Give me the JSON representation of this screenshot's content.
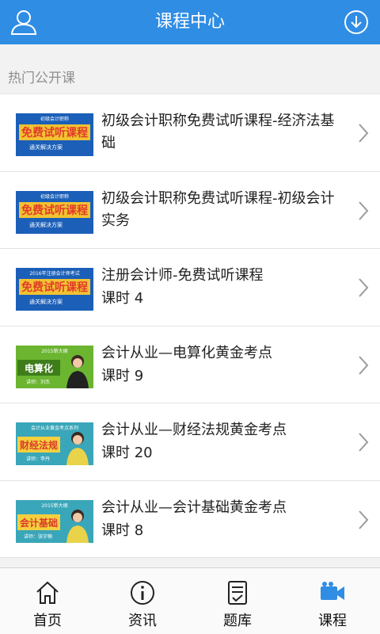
{
  "header": {
    "title": "课程中心"
  },
  "section": {
    "title": "热门公开课"
  },
  "courses": [
    {
      "title": "初级会计职称免费试听课程-经济法基础",
      "subtitle": "",
      "thumb": {
        "kind": "blue",
        "top": "初级会计职称",
        "big": "免费试听课程",
        "bottom": "通关解决方案"
      }
    },
    {
      "title": "初级会计职称免费试听课程-初级会计实务",
      "subtitle": "",
      "thumb": {
        "kind": "blue",
        "top": "初级会计职称",
        "big": "免费试听课程",
        "bottom": "通关解决方案"
      }
    },
    {
      "title": "注册会计师-免费试听课程",
      "subtitle": "课时 4",
      "thumb": {
        "kind": "blue",
        "top": "2016年注册会计师考试",
        "big": "免费试听课程",
        "bottom": "通关解决方案"
      }
    },
    {
      "title": "会计从业—电算化黄金考点",
      "subtitle": "课时 9",
      "thumb": {
        "kind": "green",
        "top": "2015新大纲",
        "big": "电算化",
        "bottom": "讲师：刘杰"
      }
    },
    {
      "title": "会计从业—财经法规黄金考点",
      "subtitle": "课时 20",
      "thumb": {
        "kind": "teal",
        "top": "会计从业黄金考点系列",
        "big": "财经法规",
        "bottom": "讲师：李丹"
      }
    },
    {
      "title": "会计从业—会计基础黄金考点",
      "subtitle": "课时 8",
      "thumb": {
        "kind": "teal",
        "top": "2015新大纲",
        "big": "会计基础",
        "bottom": "讲师：张宇楠"
      }
    }
  ],
  "tabs": [
    {
      "label": "首页",
      "icon": "home-icon",
      "active": false
    },
    {
      "label": "资讯",
      "icon": "info-icon",
      "active": false
    },
    {
      "label": "题库",
      "icon": "quiz-icon",
      "active": false
    },
    {
      "label": "课程",
      "icon": "video-icon",
      "active": true
    }
  ],
  "colors": {
    "header": "#2f8de4",
    "active_tab": "#2f8de4",
    "thumb_blue": "#1b5fb8",
    "thumb_banner": "#f1c232"
  }
}
